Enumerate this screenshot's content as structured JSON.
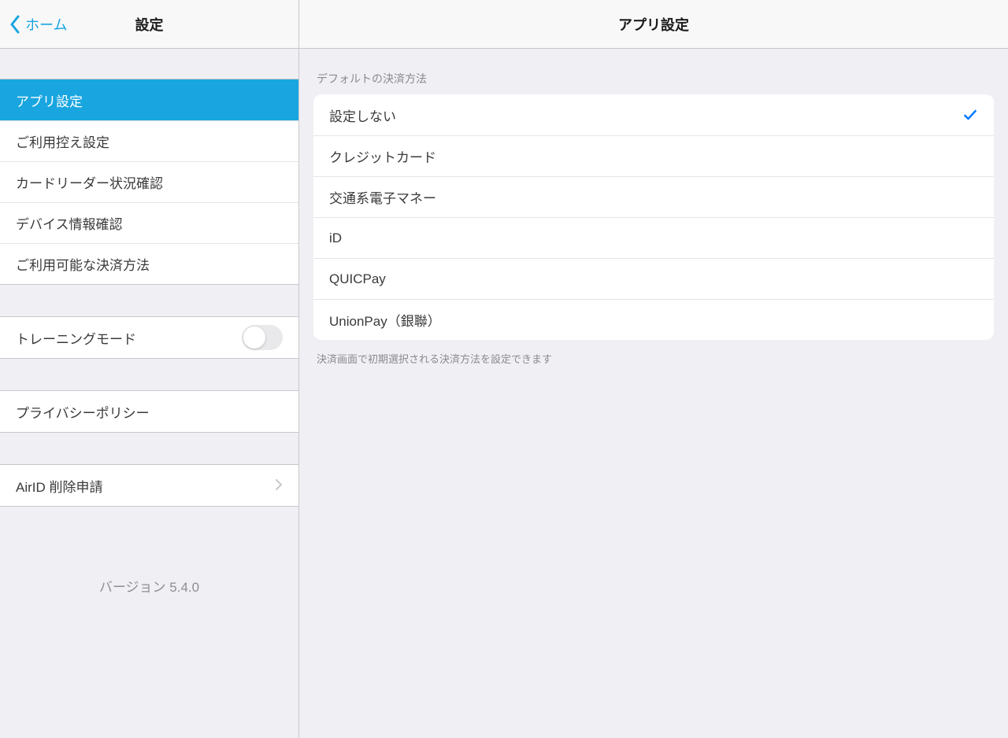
{
  "sidebar": {
    "back_label": "ホーム",
    "title": "設定",
    "groups": [
      {
        "items": [
          {
            "label": "アプリ設定",
            "selected": true
          },
          {
            "label": "ご利用控え設定"
          },
          {
            "label": "カードリーダー状況確認"
          },
          {
            "label": "デバイス情報確認"
          },
          {
            "label": "ご利用可能な決済方法"
          }
        ]
      },
      {
        "items": [
          {
            "label": "トレーニングモード",
            "toggle": false
          }
        ]
      },
      {
        "items": [
          {
            "label": "プライバシーポリシー"
          }
        ]
      },
      {
        "items": [
          {
            "label": "AirID 削除申請",
            "disclosure": true
          }
        ]
      }
    ],
    "version": "バージョン 5.4.0"
  },
  "detail": {
    "title": "アプリ設定",
    "section_header": "デフォルトの決済方法",
    "options": [
      {
        "label": "設定しない",
        "checked": true
      },
      {
        "label": "クレジットカード"
      },
      {
        "label": "交通系電子マネー"
      },
      {
        "label": "iD"
      },
      {
        "label": "QUICPay"
      },
      {
        "label": "UnionPay（銀聯）"
      }
    ],
    "section_footer": "決済画面で初期選択される決済方法を設定できます"
  },
  "colors": {
    "accent": "#18a5e0",
    "check": "#0a7aff"
  }
}
